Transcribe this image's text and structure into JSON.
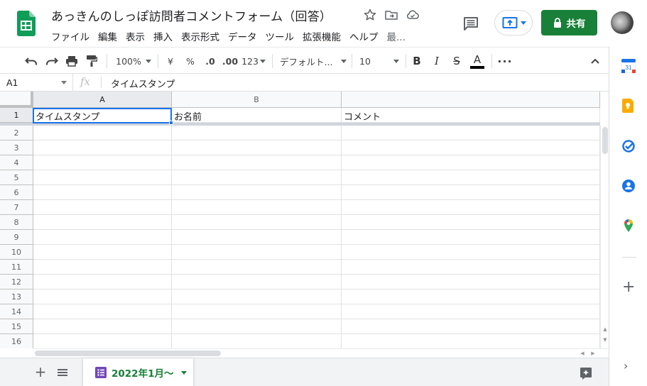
{
  "header": {
    "title": "あっきんのしっぽ訪問者コメントフォーム（回答）",
    "menu": [
      "ファイル",
      "編集",
      "表示",
      "挿入",
      "表示形式",
      "データ",
      "ツール",
      "拡張機能",
      "ヘルプ",
      "最..."
    ],
    "share_label": "共有"
  },
  "toolbar": {
    "zoom": "100%",
    "currency": "¥",
    "percent": "%",
    "decrease_decimal": ".0",
    "increase_decimal": ".00",
    "number_format": "123",
    "font": "デフォルト...",
    "font_size": "10"
  },
  "formula_bar": {
    "cell_ref": "A1",
    "fx": "fx",
    "content": "タイムスタンプ"
  },
  "grid": {
    "columns": [
      "A",
      "B"
    ],
    "rows": [
      "1",
      "2",
      "3",
      "4",
      "5",
      "6",
      "7",
      "8",
      "9",
      "10",
      "11",
      "12",
      "13",
      "14",
      "15",
      "16"
    ],
    "header_cells": [
      "タイムスタンプ",
      "お名前",
      "コメント"
    ]
  },
  "sheet_tab": {
    "label": "2022年1月〜"
  },
  "side_panel": {
    "calendar_day": "31"
  },
  "colors": {
    "accent": "#1a73e8",
    "share_green": "#188038",
    "sheets_green": "#0f9d58",
    "forms_purple": "#7248b9",
    "keep_yellow": "#f9ab00"
  }
}
